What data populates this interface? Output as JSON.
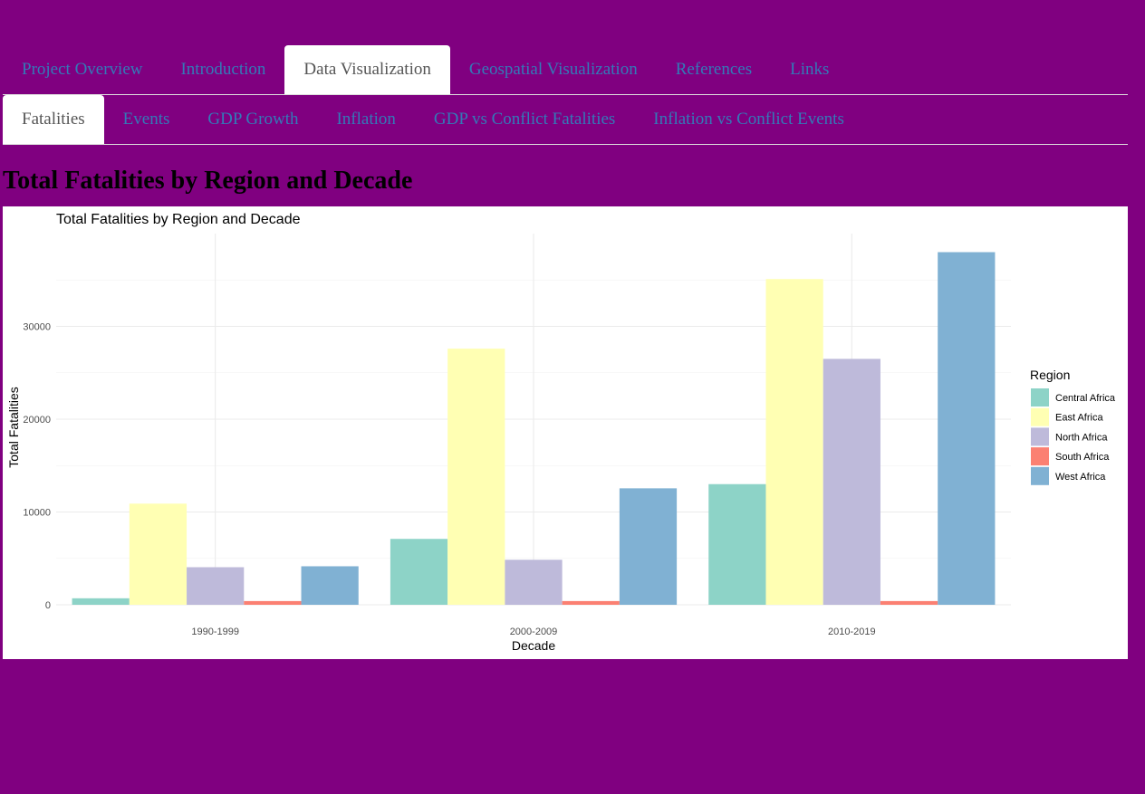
{
  "nav": {
    "main_tabs": [
      {
        "label": "Project Overview",
        "active": false
      },
      {
        "label": "Introduction",
        "active": false
      },
      {
        "label": "Data Visualization",
        "active": true
      },
      {
        "label": "Geospatial Visualization",
        "active": false
      },
      {
        "label": "References",
        "active": false
      },
      {
        "label": "Links",
        "active": false
      }
    ],
    "sub_tabs": [
      {
        "label": "Fatalities",
        "active": true
      },
      {
        "label": "Events",
        "active": false
      },
      {
        "label": "GDP Growth",
        "active": false
      },
      {
        "label": "Inflation",
        "active": false
      },
      {
        "label": "GDP vs Conflict Fatalities",
        "active": false
      },
      {
        "label": "Inflation vs Conflict Events",
        "active": false
      }
    ]
  },
  "page": {
    "heading": "Total Fatalities by Region and Decade",
    "background": "#800080",
    "link_color": "#337ab7"
  },
  "chart_data": {
    "type": "bar",
    "title": "Total Fatalities by Region and Decade",
    "xlabel": "Decade",
    "ylabel": "Total Fatalities",
    "categories": [
      "1990-1999",
      "2000-2009",
      "2010-2019"
    ],
    "series": [
      {
        "name": "Central Africa",
        "color": "#8DD3C7",
        "values": [
          700,
          7100,
          13000
        ]
      },
      {
        "name": "East Africa",
        "color": "#FFFFB3",
        "values": [
          10900,
          27600,
          35100
        ]
      },
      {
        "name": "North Africa",
        "color": "#BEBADA",
        "values": [
          4050,
          4850,
          26500
        ]
      },
      {
        "name": "South Africa",
        "color": "#FB8072",
        "values": [
          400,
          400,
          400
        ]
      },
      {
        "name": "West Africa",
        "color": "#80B1D3",
        "values": [
          4150,
          12550,
          38000
        ]
      }
    ],
    "ylim": [
      0,
      40000
    ],
    "yticks": [
      0,
      10000,
      20000,
      30000
    ],
    "legend": {
      "title": "Region",
      "position": "right"
    },
    "grid": true
  }
}
